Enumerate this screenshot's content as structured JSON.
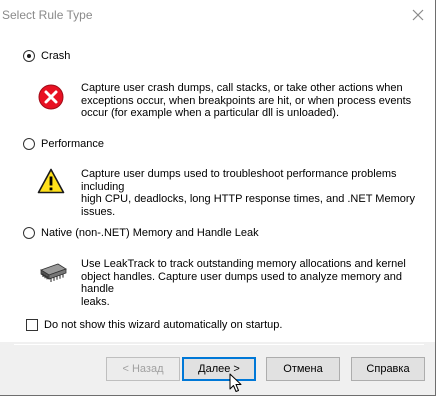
{
  "window": {
    "title": "Select Rule Type"
  },
  "options": [
    {
      "label": "Crash",
      "checked": true,
      "icon": "error-icon",
      "description_lines": [
        "Capture user crash dumps, call stacks, or take other actions when",
        "exceptions occur, when breakpoints are hit, or when process events",
        "occur (for example when a particular dll is unloaded)."
      ]
    },
    {
      "label": "Performance",
      "checked": false,
      "icon": "warning-icon",
      "description_lines": [
        "Capture user dumps used to troubleshoot performance problems including",
        "high CPU, deadlocks, long HTTP response times, and .NET Memory",
        "issues."
      ]
    },
    {
      "label": "Native (non-.NET) Memory and Handle Leak",
      "checked": false,
      "icon": "memory-chip-icon",
      "description_lines": [
        "Use LeakTrack to track outstanding memory allocations and kernel",
        "object handles. Capture user dumps used to analyze memory and handle",
        "leaks."
      ]
    }
  ],
  "checkbox": {
    "label": "Do not show this wizard automatically on startup.",
    "checked": false
  },
  "buttons": {
    "back": "< Назад",
    "next": "Далее >",
    "cancel": "Отмена",
    "help": "Справка"
  },
  "colors": {
    "error_red": "#e81123",
    "warning_yellow": "#ffe11a",
    "accent_blue": "#0078d7"
  }
}
